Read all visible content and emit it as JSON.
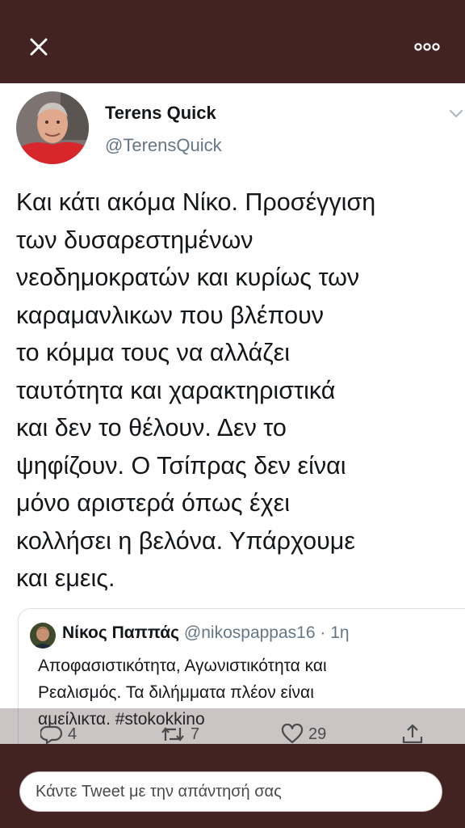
{
  "header": {
    "close_icon": "close-icon",
    "more_icon": "more-dots-icon"
  },
  "tweet": {
    "author": {
      "display_name": "Terens Quick",
      "handle": "@TerensQuick"
    },
    "text_lines": [
      "Και κάτι ακόμα Νίκο. Προσέγγιση",
      "των δυσαρεστημένων",
      "νεοδημοκρατών και κυρίως των",
      "καραμανλικων που βλέπουν",
      "το κόμμα τους να αλλάζει",
      "ταυτότητα και χαρακτηριστικά",
      "και δεν το θέλουν. Δεν το",
      "ψηφίζουν. Ο Τσίπρας δεν είναι",
      "μόνο αριστερά όπως έχει",
      "κολλήσει η βελόνα. Υπάρχουμε",
      "και εμεις."
    ],
    "quoted": {
      "display_name": "Νίκος Παππάς",
      "handle": "@nikospappas16",
      "time": "· 1η",
      "text_lines": [
        "Αποφασιστικότητα, Αγωνιστικότητα και",
        "Ρεαλισμός. Τα διλήμματα πλέον είναι",
        "αμείλικτα. #stokokkino"
      ]
    },
    "actions": {
      "reply_count": "4",
      "retweet_count": "7",
      "like_count": "29"
    }
  },
  "reply_bar": {
    "placeholder": "Κάντε Tweet με την απάντησή σας"
  },
  "colors": {
    "bar_background": "#432322",
    "secondary_text": "#657786"
  }
}
